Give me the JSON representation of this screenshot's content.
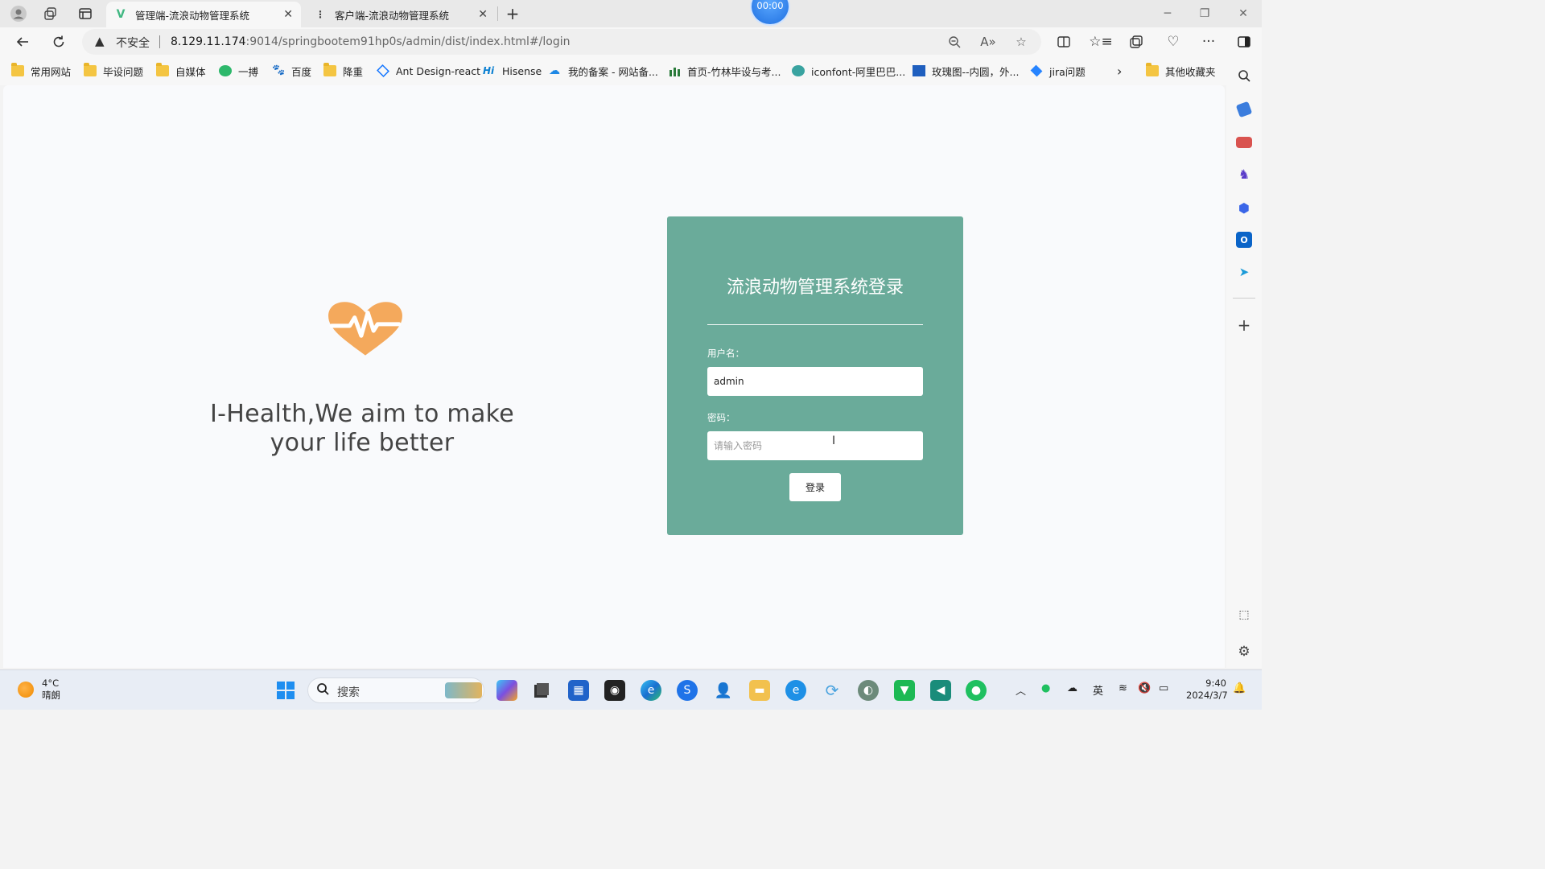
{
  "browser": {
    "tabs": [
      {
        "title": "管理端-流浪动物管理系统",
        "active": true
      },
      {
        "title": "客户端-流浪动物管理系统",
        "active": false
      }
    ],
    "recording_timer": "00:00",
    "address": {
      "security_label": "不安全",
      "host": "8.129.11.174",
      "rest": ":9014/springbootem91hp0s/admin/dist/index.html#/login"
    },
    "bookmarks": [
      {
        "label": "常用网站",
        "icon": "folder-icon"
      },
      {
        "label": "毕设问题",
        "icon": "folder-icon"
      },
      {
        "label": "自媒体",
        "icon": "folder-icon"
      },
      {
        "label": "一搏",
        "icon": "leaf-icon"
      },
      {
        "label": "百度",
        "icon": "baidu-paw-icon"
      },
      {
        "label": "降重",
        "icon": "folder-icon"
      },
      {
        "label": "Ant Design-react",
        "icon": "ant-design-icon"
      },
      {
        "label": "Hisense",
        "icon": "hisense-icon"
      },
      {
        "label": "我的备案 - 网站备...",
        "icon": "cloud-icon"
      },
      {
        "label": "首页-竹林毕设与考...",
        "icon": "site-icon"
      },
      {
        "label": "iconfont-阿里巴巴...",
        "icon": "iconfont-icon"
      },
      {
        "label": "玫瑰图--内圆，外...",
        "icon": "chart-icon"
      },
      {
        "label": "jira问题",
        "icon": "jira-icon"
      }
    ],
    "other_bookmarks": "其他收藏夹"
  },
  "page": {
    "slogan_line1": "I-Health,We aim to make",
    "slogan_line2": "your life better",
    "login": {
      "title": "流浪动物管理系统登录",
      "username_label": "用户名：",
      "username_value": "admin",
      "password_label": "密码：",
      "password_placeholder": "请输入密码",
      "submit_label": "登录"
    },
    "colors": {
      "card": "#6aab9a",
      "heart": "#f4a95c"
    }
  },
  "taskbar": {
    "weather_temp": "4°C",
    "weather_desc": "晴朗",
    "search_placeholder": "搜索",
    "ime": "英",
    "time": "9:40",
    "date": "2024/3/7"
  }
}
